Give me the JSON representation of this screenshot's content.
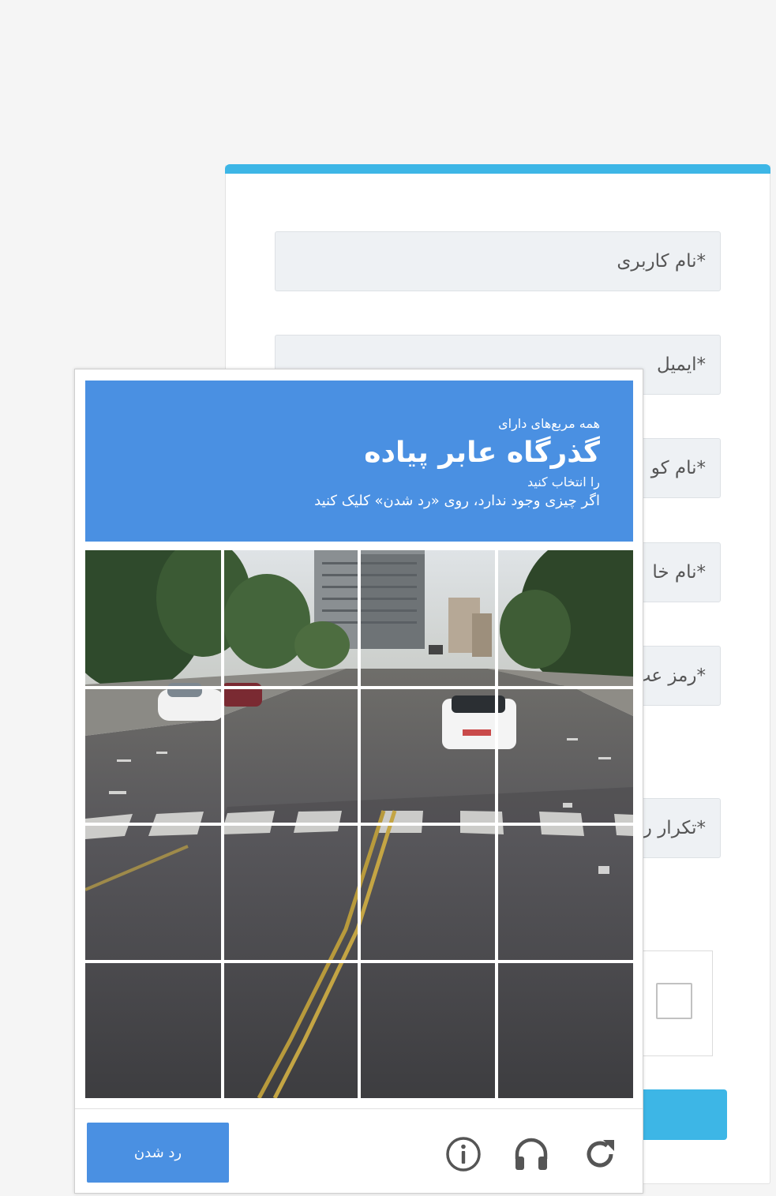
{
  "form": {
    "fields": [
      {
        "placeholder": "*نام کاربری"
      },
      {
        "placeholder": "*ایمیل"
      },
      {
        "placeholder": "*نام کو"
      },
      {
        "placeholder": "*نام خا"
      },
      {
        "placeholder": "*رمز عب"
      },
      {
        "placeholder": "*تکرار ر"
      }
    ],
    "accent_color": "#3db6e6"
  },
  "captcha": {
    "instruction_top": "همه مربع‌های دارای",
    "target": "گذرگاه عابر پیاده",
    "instruction_select": "را انتخاب کنید",
    "instruction_skip": "اگر چیزی وجود ندارد، روی «رد شدن» کلیک کنید",
    "skip_label": "رد شدن",
    "header_color": "#4a90e2",
    "grid_rows": 4,
    "grid_cols": 4
  },
  "icons": {
    "info": "info-icon",
    "audio": "headphones-icon",
    "reload": "reload-icon"
  }
}
